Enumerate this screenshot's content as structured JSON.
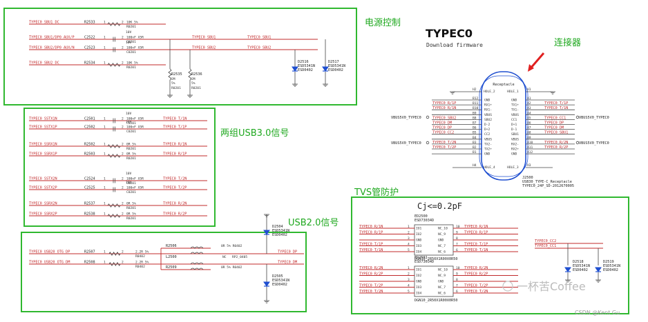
{
  "sections": {
    "power": "电源控制",
    "connector": "连接器",
    "usb3": "两组USB3.0信号",
    "usb2": "USB2.0信号",
    "tvs": "TVS管防护"
  },
  "title": "TYPEC0",
  "subtitle": "Download firmware",
  "cj_note": "Cj<=0.2pF",
  "watermark": "一杯苦Coffee",
  "credit": "CSDN @Kent Gu",
  "power_rows": [
    {
      "net_in": "TYPEC0_SBU1_DC",
      "ref": "R2533",
      "val": "10K 5%",
      "pkg": "R0201",
      "p1": "1",
      "p2": "2"
    },
    {
      "net_in": "TYPEC0_SBU1/DP0_AUX/P",
      "ref": "C2522",
      "val": "100nF X5R",
      "pkg": "C0201",
      "v": "10V",
      "p1": "1",
      "p2": "2"
    },
    {
      "net_in": "TYPEC0_SBU2/DP0_AUX/N",
      "ref": "C2523",
      "val": "100nF X5R",
      "pkg": "C0201",
      "v": "10V",
      "p1": "1",
      "p2": "2"
    },
    {
      "net_in": "TYPEC0_SBU2_DC",
      "ref": "R2534",
      "val": "10K 5%",
      "pkg": "R0201",
      "p1": "1",
      "p2": "2"
    }
  ],
  "power_out": [
    "TYPEC0_SBU1",
    "TYPEC0_SBU2"
  ],
  "power_out2": [
    "TYPEC0_SBU1",
    "TYPEC0_SBU2"
  ],
  "pulldowns": [
    {
      "ref": "R2535",
      "val": "2M",
      "tol": "5%",
      "pkg": "R0201"
    },
    {
      "ref": "R2536",
      "val": "2M",
      "tol": "5%",
      "pkg": "R0201"
    }
  ],
  "esd_power": [
    {
      "ref": "D2516",
      "part": "ESD5341N",
      "pkg": "ESD0402"
    },
    {
      "ref": "D2517",
      "part": "ESD5341N",
      "pkg": "ESD0402"
    }
  ],
  "usb3_rows": [
    {
      "net_in": "TYPEC0_SSTX1N",
      "ref": "C2501",
      "val": "100nF X5R",
      "pkg": "C0201",
      "v": "10V",
      "net_out": "TYPEC0_T/1N",
      "kind": "cap"
    },
    {
      "net_in": "TYPEC0_SSTX1P",
      "ref": "C2502",
      "val": "100nF X5R",
      "pkg": "C0201",
      "v": "10V",
      "net_out": "TYPEC0_T/1P",
      "kind": "cap"
    },
    {
      "net_in": "TYPEC0_SSRX1N",
      "ref": "R2502",
      "val": "0R 5%",
      "pkg": "R0201",
      "net_out": "TYPEC0_R/1N",
      "kind": "res"
    },
    {
      "net_in": "TYPEC0_SSRX1P",
      "ref": "R2503",
      "val": "0R 5%",
      "pkg": "R0201",
      "net_out": "TYPEC0_R/1P",
      "kind": "res"
    },
    {
      "net_in": "TYPEC0_SSTX2N",
      "ref": "C2524",
      "val": "100nF X5R",
      "pkg": "C0201",
      "v": "10V",
      "net_out": "TYPEC0_T/2N",
      "kind": "cap"
    },
    {
      "net_in": "TYPEC0_SSTX2P",
      "ref": "C2525",
      "val": "100nF X5R",
      "pkg": "C0201",
      "v": "10V",
      "net_out": "TYPEC0_T/2P",
      "kind": "cap"
    },
    {
      "net_in": "TYPEC0_SSRX2N",
      "ref": "R2537",
      "val": "0R 5%",
      "pkg": "R0201",
      "net_out": "TYPEC0_R/2N",
      "kind": "res"
    },
    {
      "net_in": "TYPEC0_SSRX2P",
      "ref": "R2538",
      "val": "0R 5%",
      "pkg": "R0201",
      "net_out": "TYPEC0_R/2P",
      "kind": "res"
    }
  ],
  "usb2": {
    "in_dp": "TYPEC0_USB20_OTG_DP",
    "in_dm": "TYPEC0_USB20_OTG_DM",
    "r1": {
      "ref": "R2507",
      "val": "2.2R 5%",
      "pkg": "R0402"
    },
    "r2": {
      "ref": "R2508",
      "val": "2.2R 5%",
      "pkg": "R0402"
    },
    "r3": {
      "ref": "R2506",
      "val": "0R 5% R0402"
    },
    "r4": {
      "ref": "R2509",
      "val": "0R 5% R0402"
    },
    "l": {
      "ref": "L2500",
      "val": "NC",
      "pkg": "RP2_0405"
    },
    "out_dp": "TYPEC0_DP",
    "out_dm": "TYPEC0_DM",
    "d1": {
      "ref": "D2504",
      "part": "ESD5341N",
      "pkg": "ESD0402"
    },
    "d2": {
      "ref": "D2505",
      "part": "ESD5341N",
      "pkg": "ESD0402"
    }
  },
  "connector": {
    "name": "Receptacle",
    "ref": "J2500",
    "part": "USB30_TYPE-C_Receptacle",
    "pkg": "TYPEC0_24P_SD-2012670005",
    "top_pins": [
      "H2",
      "HOLE_2",
      "HOLE_1",
      "H1"
    ],
    "bot_pins": [
      "H4",
      "HOLE_4",
      "HOLE_3",
      "H3"
    ],
    "vbus_left1": "VBUS5V0_TYPEC0",
    "vbus_left2": "VBUS5V0_TYPEC0",
    "vbus_right1": "VBUS5V0_TYPEC0",
    "vbus_right2": "VBUS5V0_TYPEC0",
    "left": [
      {
        "net": "",
        "pin": "B12",
        "name": "GND"
      },
      {
        "net": "TYPEC0_R/1P",
        "pin": "B11",
        "name": "RX1+"
      },
      {
        "net": "TYPEC0_R/1N",
        "pin": "B10",
        "name": "RX1-"
      },
      {
        "net": "",
        "pin": "B9",
        "name": "VBUS"
      },
      {
        "net": "TYPEC0_SBU2",
        "pin": "B8",
        "name": "SBU2"
      },
      {
        "net": "TYPEC0_DM",
        "pin": "B7",
        "name": "D-2"
      },
      {
        "net": "TYPEC0_DP",
        "pin": "B6",
        "name": "D+2"
      },
      {
        "net": "TYPEC0_CC2",
        "pin": "B5",
        "name": "CC2"
      },
      {
        "net": "",
        "pin": "B4",
        "name": "VBUS"
      },
      {
        "net": "TYPEC0_T/2N",
        "pin": "B3",
        "name": "TX2-"
      },
      {
        "net": "TYPEC0_T/2P",
        "pin": "B2",
        "name": "TX2+"
      },
      {
        "net": "",
        "pin": "B1",
        "name": "GND"
      }
    ],
    "right": [
      {
        "net": "",
        "pin": "A1",
        "name": "GND"
      },
      {
        "net": "TYPEC0_T/1P",
        "pin": "A2",
        "name": "TX1+"
      },
      {
        "net": "TYPEC0_T/1N",
        "pin": "A3",
        "name": "TX1-"
      },
      {
        "net": "",
        "pin": "A4",
        "name": "VBUS"
      },
      {
        "net": "TYPEC0_CC1",
        "pin": "A5",
        "name": "CC1"
      },
      {
        "net": "TYPEC0_DP",
        "pin": "A6",
        "name": "D+1"
      },
      {
        "net": "TYPEC0_DM",
        "pin": "A7",
        "name": "D-1"
      },
      {
        "net": "TYPEC0_SBU1",
        "pin": "A8",
        "name": "SBU1"
      },
      {
        "net": "",
        "pin": "A9",
        "name": "VBUS"
      },
      {
        "net": "TYPEC0_R/2N",
        "pin": "A10",
        "name": "RX2-"
      },
      {
        "net": "TYPEC0_R/2P",
        "pin": "A11",
        "name": "RX2+"
      },
      {
        "net": "",
        "pin": "A12",
        "name": "GND"
      }
    ]
  },
  "tvs": {
    "u1": {
      "ref": "ED2500",
      "part": "ESD73034D",
      "pkg": "DGN10_2R50X1R00X0R50"
    },
    "u2": {
      "ref": "ED2501",
      "part": "ESD73034D",
      "pkg": "DGN10_2R50X1R00X0R50"
    },
    "pins_left": [
      {
        "p": "1",
        "n": "IO1"
      },
      {
        "p": "2",
        "n": "IO2"
      },
      {
        "p": "3",
        "n": "GND"
      },
      {
        "p": "4",
        "n": "IO3"
      },
      {
        "p": "5",
        "n": "IO4"
      }
    ],
    "pins_right": [
      {
        "p": "10",
        "n": "NC_10"
      },
      {
        "p": "9",
        "n": "NC_9"
      },
      {
        "p": "8",
        "n": "GND"
      },
      {
        "p": "7",
        "n": "NC_7"
      },
      {
        "p": "6",
        "n": "NC_6"
      }
    ],
    "u1_left": [
      "TYPEC0_R/1N",
      "TYPEC0_R/1P",
      "",
      "TYPEC0_T/1P",
      "TYPEC0_T/1N"
    ],
    "u1_right": [
      "TYPEC0_R/1N",
      "TYPEC0_R/1P",
      "",
      "TYPEC0_T/1P",
      "TYPEC0_T/1N"
    ],
    "u2_left": [
      "TYPEC0_R/2N",
      "TYPEC0_R/2P",
      "",
      "TYPEC0_T/2P",
      "TYPEC0_T/2N"
    ],
    "u2_right": [
      "TYPEC0_R/2N",
      "TYPEC0_R/2P",
      "",
      "TYPEC0_T/2P",
      "TYPEC0_T/2N"
    ],
    "cc_nets": [
      "TYPEC0_CC2",
      "TYPEC0_CC1"
    ],
    "d1": {
      "ref": "D2518",
      "part": "ESD5341N",
      "pkg": "ESD0402"
    },
    "d2": {
      "ref": "D2519",
      "part": "ESD5341N",
      "pkg": "ESD0402"
    }
  }
}
